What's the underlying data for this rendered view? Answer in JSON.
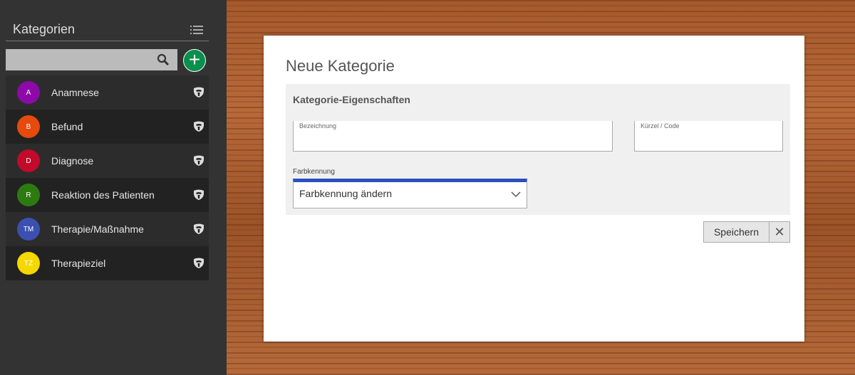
{
  "sidebar": {
    "title": "Kategorien",
    "search": {
      "placeholder": "",
      "value": ""
    },
    "items": [
      {
        "initials": "A",
        "label": "Anamnese",
        "color": "#8e0aa8"
      },
      {
        "initials": "B",
        "label": "Befund",
        "color": "#e64a0c"
      },
      {
        "initials": "D",
        "label": "Diagnose",
        "color": "#c20a2a"
      },
      {
        "initials": "R",
        "label": "Reaktion des Patienten",
        "color": "#2d7a10"
      },
      {
        "initials": "TM",
        "label": "Therapie/Maßnahme",
        "color": "#3b50b0"
      },
      {
        "initials": "TZ",
        "label": "Therapieziel",
        "color": "#f5d800"
      }
    ]
  },
  "dialog": {
    "title": "Neue Kategorie",
    "section_title": "Kategorie-Eigenschaften",
    "name_label": "Bezeichnung",
    "code_label": "Kürzel / Code",
    "color_label": "Farbkennung",
    "color_select": "Farbkennung ändern",
    "save_label": "Speichern",
    "close_label": "✕"
  }
}
